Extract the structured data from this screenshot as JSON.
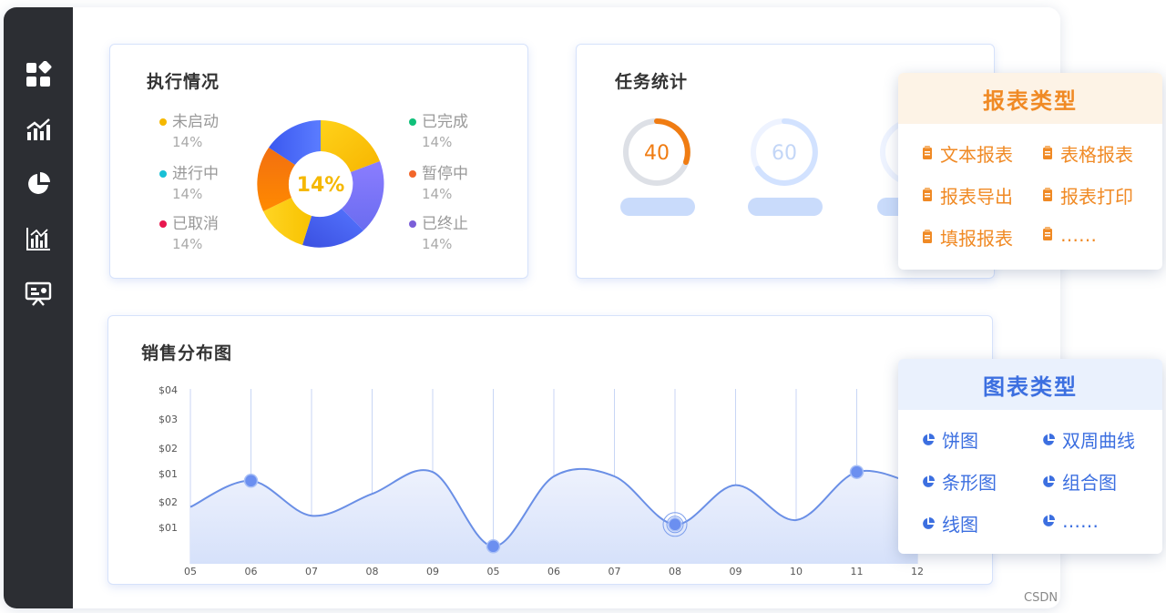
{
  "exec_card": {
    "title": "执行情况",
    "center_value": "14%",
    "legend": [
      {
        "label": "未启动",
        "pct": "14%",
        "color": "#f5b800"
      },
      {
        "label": "进行中",
        "pct": "14%",
        "color": "#18c0d6"
      },
      {
        "label": "已取消",
        "pct": "14%",
        "color": "#e8174e"
      },
      {
        "label": "已完成",
        "pct": "14%",
        "color": "#10c07a"
      },
      {
        "label": "暂停中",
        "pct": "14%",
        "color": "#f2662a"
      },
      {
        "label": "已终止",
        "pct": "14%",
        "color": "#7b5fd8"
      }
    ]
  },
  "task_card": {
    "title": "任务统计",
    "gauges": [
      {
        "value": "40",
        "fraction": 0.4,
        "color": "#f07c12"
      },
      {
        "value": "60",
        "fraction": 0.6,
        "color": "#d2e2ff"
      }
    ]
  },
  "sales_card": {
    "title": "销售分布图"
  },
  "chart_data": {
    "type": "area",
    "title": "销售分布图",
    "x": [
      "05",
      "06",
      "07",
      "08",
      "09",
      "05",
      "06",
      "07",
      "08",
      "09",
      "10",
      "11",
      "12"
    ],
    "y_tick_labels": [
      "$04",
      "$03",
      "$02",
      "$01",
      "$02",
      "$01"
    ],
    "grid": "vertical",
    "series": [
      {
        "values": [
          1.3,
          1.9,
          1.1,
          1.6,
          2.1,
          0.4,
          2.0,
          2.0,
          0.9,
          1.8,
          1.0,
          2.1,
          1.8
        ],
        "color": "#6a8fe6"
      }
    ],
    "highlighted_points": [
      "06",
      "05",
      "07",
      "11"
    ]
  },
  "report_types": {
    "title": "报表类型",
    "items": [
      "文本报表",
      "表格报表",
      "报表导出",
      "报表打印",
      "填报报表",
      "……"
    ],
    "accent": "#f08a25"
  },
  "chart_types": {
    "title": "图表类型",
    "items": [
      "饼图",
      "双周曲线",
      "条形图",
      "组合图",
      "线图",
      "……"
    ],
    "accent": "#3c6fe0"
  },
  "sidebar": {
    "icons": [
      "dashboard-icon",
      "trend-chart-icon",
      "pie-chart-icon",
      "bar-chart-icon",
      "presentation-icon"
    ]
  },
  "watermark": "CSDN"
}
